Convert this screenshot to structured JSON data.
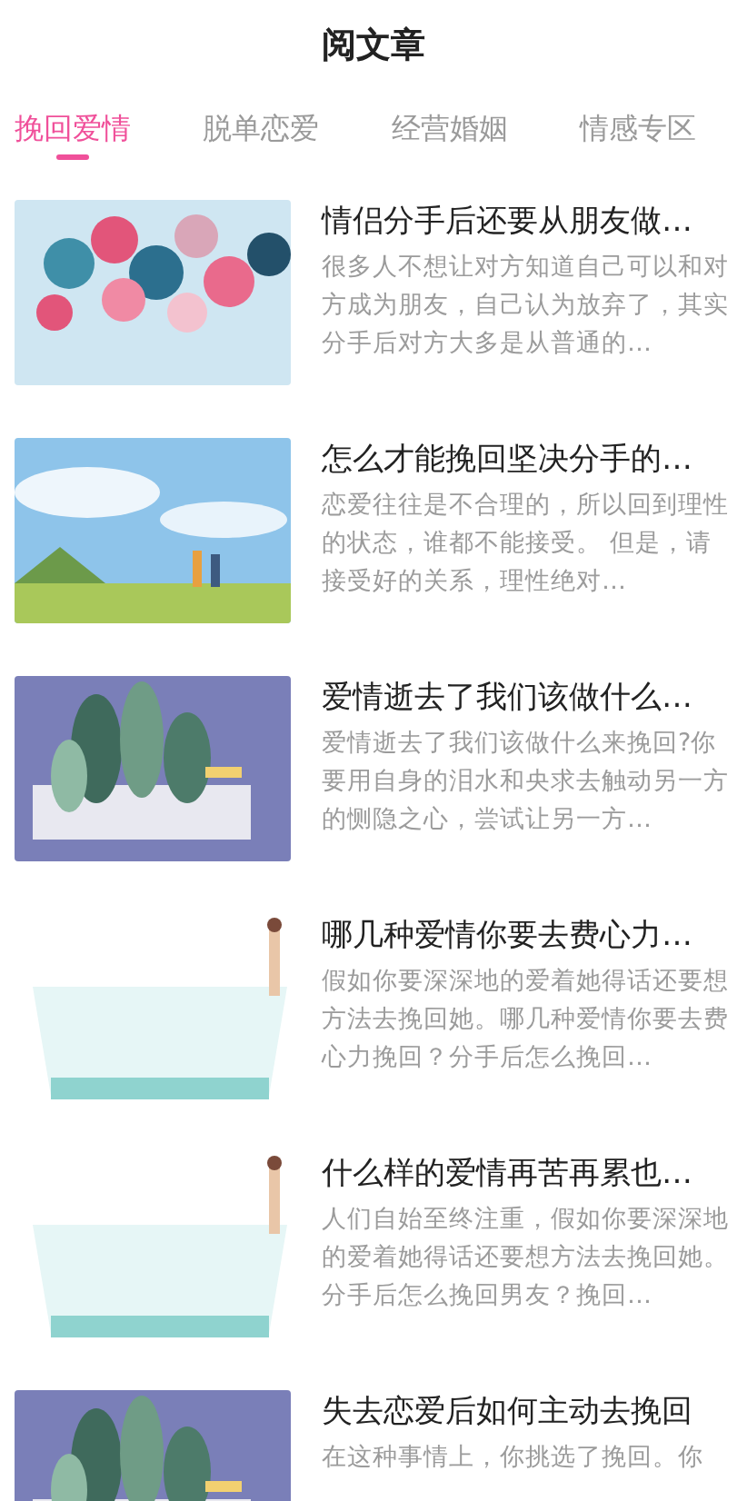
{
  "header": {
    "title": "阅文章"
  },
  "tabs": [
    {
      "label": "挽回爱情",
      "selected": true
    },
    {
      "label": "脱单恋爱",
      "selected": false
    },
    {
      "label": "经营婚姻",
      "selected": false
    },
    {
      "label": "情感专区",
      "selected": false
    }
  ],
  "articles": [
    {
      "title": "情侣分手后还要从朋友做…",
      "excerpt": "很多人不想让对方知道自己可以和对方成为朋友，自己认为放弃了，其实分手后对方大多是从普通的…"
    },
    {
      "title": "怎么才能挽回坚决分手的…",
      "excerpt": "恋爱往往是不合理的，所以回到理性的状态，谁都不能接受。 但是，请接受好的关系，理性绝对…"
    },
    {
      "title": "爱情逝去了我们该做什么…",
      "excerpt": "爱情逝去了我们该做什么来挽回?你要用自身的泪水和央求去触动另一方的恻隐之心，尝试让另一方…"
    },
    {
      "title": "哪几种爱情你要去费心力…",
      "excerpt": "假如你要深深地的爱着她得话还要想方法去挽回她。哪几种爱情你要去费心力挽回？分手后怎么挽回…"
    },
    {
      "title": "什么样的爱情再苦再累也…",
      "excerpt": "人们自始至终注重，假如你要深深地的爱着她得话还要想方法去挽回她。分手后怎么挽回男友？挽回…"
    },
    {
      "title": "失去恋爱后如何主动去挽回",
      "excerpt": "在这种事情上，你挑选了挽回。你"
    }
  ]
}
